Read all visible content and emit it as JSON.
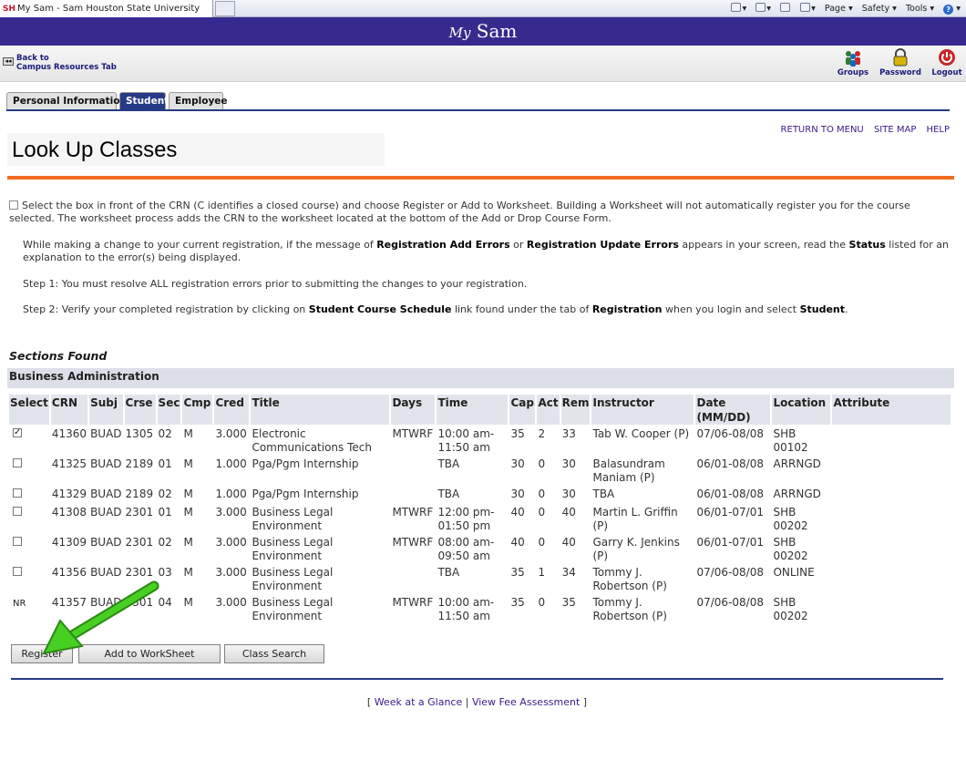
{
  "browser": {
    "favicon_text": "SH",
    "tab_title": "My Sam - Sam Houston State University",
    "commands": {
      "page": "Page",
      "safety": "Safety",
      "tools": "Tools",
      "help": "?"
    }
  },
  "banner": {
    "my": "My",
    "sam": "Sam"
  },
  "topnav": {
    "back_line1": "Back to",
    "back_line2": "Campus Resources Tab",
    "tools": [
      {
        "label": "Groups",
        "icon": "groups-icon"
      },
      {
        "label": "Password",
        "icon": "password-icon"
      },
      {
        "label": "Logout",
        "icon": "logout-icon"
      }
    ]
  },
  "tabs": [
    "Personal Information",
    "Student",
    "Employee"
  ],
  "active_tab": "Student",
  "right_links": [
    "RETURN TO MENU",
    "SITE MAP",
    "HELP"
  ],
  "page_title": "Look Up Classes",
  "info": {
    "p1": "Select the box in front of the CRN (C identifies a closed course) and choose Register or Add to Worksheet. Building a Worksheet will not automatically register you for the course selected. The worksheet process adds the CRN to the worksheet located at the bottom of the Add or Drop Course Form.",
    "p2_a": "While making a change to your current registration, if the message of ",
    "p2_b": "Registration Add Errors",
    "p2_c": " or ",
    "p2_d": "Registration Update Errors",
    "p2_e": " appears in your screen, read the ",
    "p2_f": "Status",
    "p2_g": " listed for an explanation to the error(s) being displayed.",
    "p3": "Step 1: You must resolve ALL registration errors prior to submitting the changes to your registration.",
    "p4_a": "Step 2: Verify your completed registration by clicking on ",
    "p4_b": "Student Course Schedule",
    "p4_c": " link found under the tab of ",
    "p4_d": "Registration",
    "p4_e": " when you login and select ",
    "p4_f": "Student",
    "p4_g": "."
  },
  "sections_found": "Sections Found",
  "subject": "Business Administration",
  "columns": {
    "select": "Select",
    "crn": "CRN",
    "subj": "Subj",
    "crse": "Crse",
    "sec": "Sec",
    "cmp": "Cmp",
    "cred": "Cred",
    "title": "Title",
    "days": "Days",
    "time": "Time",
    "cap": "Cap",
    "act": "Act",
    "rem": "Rem",
    "instructor": "Instructor",
    "date": "Date (MM/DD)",
    "location": "Location",
    "attribute": "Attribute"
  },
  "rows": [
    {
      "select": "checked",
      "crn": "41360",
      "subj": "BUAD",
      "crse": "1305",
      "sec": "02",
      "cmp": "M",
      "cred": "3.000",
      "title": "Electronic Communications Tech",
      "days": "MTWRF",
      "time": "10:00 am-11:50 am",
      "cap": "35",
      "act": "2",
      "rem": "33",
      "instructor": "Tab W. Cooper (P)",
      "date": "07/06-08/08",
      "location": "SHB 00102",
      "attribute": ""
    },
    {
      "select": "box",
      "crn": "41325",
      "subj": "BUAD",
      "crse": "2189",
      "sec": "01",
      "cmp": "M",
      "cred": "1.000",
      "title": "Pga/Pgm Internship",
      "days": "",
      "time": "TBA",
      "cap": "30",
      "act": "0",
      "rem": "30",
      "instructor": "Balasundram Maniam (P)",
      "date": "06/01-08/08",
      "location": "ARRNGD",
      "attribute": ""
    },
    {
      "select": "box",
      "crn": "41329",
      "subj": "BUAD",
      "crse": "2189",
      "sec": "02",
      "cmp": "M",
      "cred": "1.000",
      "title": "Pga/Pgm Internship",
      "days": "",
      "time": "TBA",
      "cap": "30",
      "act": "0",
      "rem": "30",
      "instructor": "TBA",
      "date": "06/01-08/08",
      "location": "ARRNGD",
      "attribute": ""
    },
    {
      "select": "box",
      "crn": "41308",
      "subj": "BUAD",
      "crse": "2301",
      "sec": "01",
      "cmp": "M",
      "cred": "3.000",
      "title": "Business Legal Environment",
      "days": "MTWRF",
      "time": "12:00 pm-01:50 pm",
      "cap": "40",
      "act": "0",
      "rem": "40",
      "instructor": "Martin L. Griffin (P)",
      "date": "06/01-07/01",
      "location": "SHB 00202",
      "attribute": ""
    },
    {
      "select": "box",
      "crn": "41309",
      "subj": "BUAD",
      "crse": "2301",
      "sec": "02",
      "cmp": "M",
      "cred": "3.000",
      "title": "Business Legal Environment",
      "days": "MTWRF",
      "time": "08:00 am-09:50 am",
      "cap": "40",
      "act": "0",
      "rem": "40",
      "instructor": "Garry K. Jenkins (P)",
      "date": "06/01-07/01",
      "location": "SHB 00202",
      "attribute": ""
    },
    {
      "select": "box",
      "crn": "41356",
      "subj": "BUAD",
      "crse": "2301",
      "sec": "03",
      "cmp": "M",
      "cred": "3.000",
      "title": "Business Legal Environment",
      "days": "",
      "time": "TBA",
      "cap": "35",
      "act": "1",
      "rem": "34",
      "instructor": "Tommy J. Robertson (P)",
      "date": "07/06-08/08",
      "location": "ONLINE",
      "attribute": ""
    },
    {
      "select": "NR",
      "crn": "41357",
      "subj": "BUAD",
      "crse": "2301",
      "sec": "04",
      "cmp": "M",
      "cred": "3.000",
      "title": "Business Legal Environment",
      "days": "MTWRF",
      "time": "10:00 am-11:50 am",
      "cap": "35",
      "act": "0",
      "rem": "35",
      "instructor": "Tommy J. Robertson (P)",
      "date": "07/06-08/08",
      "location": "SHB 00202",
      "attribute": ""
    }
  ],
  "buttons": {
    "register": "Register",
    "add_worksheet": "Add to WorkSheet",
    "class_search": "Class Search"
  },
  "footer": {
    "open": "[",
    "link1": "Week at a Glance",
    "sep": "|",
    "link2": "View Fee Assessment",
    "close": "]"
  },
  "colors": {
    "banner": "#372a8e",
    "nav_blue": "#253a86",
    "accent_orange": "#f26d21",
    "link": "#2832b8",
    "arrow": "#3fbf1f"
  }
}
